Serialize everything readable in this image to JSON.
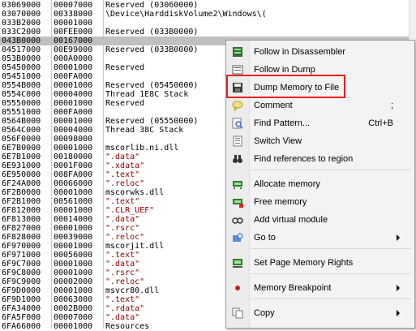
{
  "memory_map": {
    "rows": [
      {
        "addr": "03069000",
        "size": "00007000",
        "info": "Reserved (03060000)"
      },
      {
        "addr": "03070000",
        "size": "00338000",
        "info": "\\Device\\HarddiskVolume2\\Windows\\("
      },
      {
        "addr": "033B2000",
        "size": "00001000",
        "info": ""
      },
      {
        "addr": "033C2000",
        "size": "00FEE000",
        "info": "Reserved (033B0000)"
      },
      {
        "addr": "043B0000",
        "size": "00167000",
        "info": ""
      },
      {
        "addr": "04517000",
        "size": "00E99000",
        "info": "Reserved (033B0000)"
      },
      {
        "addr": "053B0000",
        "size": "000A0000",
        "info": ""
      },
      {
        "addr": "05450000",
        "size": "00001000",
        "info": "Reserved"
      },
      {
        "addr": "05451000",
        "size": "000FA000",
        "info": ""
      },
      {
        "addr": "0554B000",
        "size": "00001000",
        "info": "Reserved (05450000)"
      },
      {
        "addr": "0554C000",
        "size": "00004000",
        "info": "Thread 1E8C Stack"
      },
      {
        "addr": "05550000",
        "size": "00001000",
        "info": "Reserved"
      },
      {
        "addr": "05551000",
        "size": "000FA000",
        "info": ""
      },
      {
        "addr": "0564B000",
        "size": "00001000",
        "info": "Reserved (05550000)"
      },
      {
        "addr": "0564C000",
        "size": "00004000",
        "info": "Thread 38C Stack"
      },
      {
        "addr": "056F0000",
        "size": "00098000",
        "info": ""
      },
      {
        "addr": "6E7B0000",
        "size": "00001000",
        "info": "mscorlib.ni.dll"
      },
      {
        "addr": "6E7B1000",
        "size": "00180000",
        "info": " \".data\""
      },
      {
        "addr": "6E931000",
        "size": "0001F000",
        "info": " \".xdata\""
      },
      {
        "addr": "6E950000",
        "size": "008FA000",
        "info": " \".text\""
      },
      {
        "addr": "6F24A000",
        "size": "00066000",
        "info": " \".reloc\""
      },
      {
        "addr": "6F2B0000",
        "size": "00001000",
        "info": "mscorwks.dll"
      },
      {
        "addr": "6F2B1000",
        "size": "00561000",
        "info": " \".text\""
      },
      {
        "addr": "6F812000",
        "size": "00001000",
        "info": " \".CLR_UEF\""
      },
      {
        "addr": "6F813000",
        "size": "00014000",
        "info": " \".data\""
      },
      {
        "addr": "6F827000",
        "size": "00001000",
        "info": " \".rsrc\""
      },
      {
        "addr": "6F828000",
        "size": "00039000",
        "info": " \".reloc\""
      },
      {
        "addr": "6F970000",
        "size": "00001000",
        "info": "mscorjit.dll"
      },
      {
        "addr": "6F971000",
        "size": "00056000",
        "info": " \".text\""
      },
      {
        "addr": "6F9C7000",
        "size": "00001000",
        "info": " \".data\""
      },
      {
        "addr": "6F9C8000",
        "size": "00001000",
        "info": " \".rsrc\""
      },
      {
        "addr": "6F9C9000",
        "size": "00002000",
        "info": " \".reloc\""
      },
      {
        "addr": "6F9D0000",
        "size": "00001000",
        "info": "msvcr80.dll"
      },
      {
        "addr": "6F9D1000",
        "size": "00063000",
        "info": " \".text\""
      },
      {
        "addr": "6FA34000",
        "size": "0002B000",
        "info": " \".rdata\""
      },
      {
        "addr": "6FA5F000",
        "size": "00007000",
        "info": " \".data\""
      },
      {
        "addr": "6FA66000",
        "size": "00001000",
        "info": "Resources"
      }
    ],
    "selected_index": 4
  },
  "context_menu": {
    "items": [
      {
        "label": "Follow in Disassembler",
        "icon": "disassembler-icon",
        "shortcut": "",
        "submenu": false
      },
      {
        "label": "Follow in Dump",
        "icon": "dump-icon",
        "shortcut": "",
        "submenu": false
      },
      {
        "label": "Dump Memory to File",
        "icon": "save-disk-icon",
        "shortcut": "",
        "submenu": false
      },
      {
        "label": "Comment",
        "icon": "comment-icon",
        "shortcut": ";",
        "submenu": false
      },
      {
        "label": "Find Pattern...",
        "icon": "find-pattern-icon",
        "shortcut": "Ctrl+B",
        "submenu": false
      },
      {
        "label": "Switch View",
        "icon": "switch-view-icon",
        "shortcut": "",
        "submenu": false
      },
      {
        "label": "Find references to region",
        "icon": "binoculars-icon",
        "shortcut": "",
        "submenu": false
      },
      {
        "label": "Allocate memory",
        "icon": "allocate-memory-icon",
        "shortcut": "",
        "submenu": false
      },
      {
        "label": "Free memory",
        "icon": "free-memory-icon",
        "shortcut": "",
        "submenu": false
      },
      {
        "label": "Add virtual module",
        "icon": "virtual-module-icon",
        "shortcut": "",
        "submenu": false
      },
      {
        "label": "Go to",
        "icon": "goto-icon",
        "shortcut": "",
        "submenu": true
      },
      {
        "label": "Set Page Memory Rights",
        "icon": "memory-rights-icon",
        "shortcut": "",
        "submenu": false
      },
      {
        "label": "Memory Breakpoint",
        "icon": "breakpoint-icon",
        "shortcut": "",
        "submenu": true
      },
      {
        "label": "Copy",
        "icon": "copy-icon",
        "shortcut": "",
        "submenu": true
      }
    ],
    "highlighted_item": "Dump Memory to File"
  },
  "colors": {
    "selected_row": "#c0c0c0",
    "highlight_box": "#e3231f",
    "string_text": "#8b0000"
  }
}
